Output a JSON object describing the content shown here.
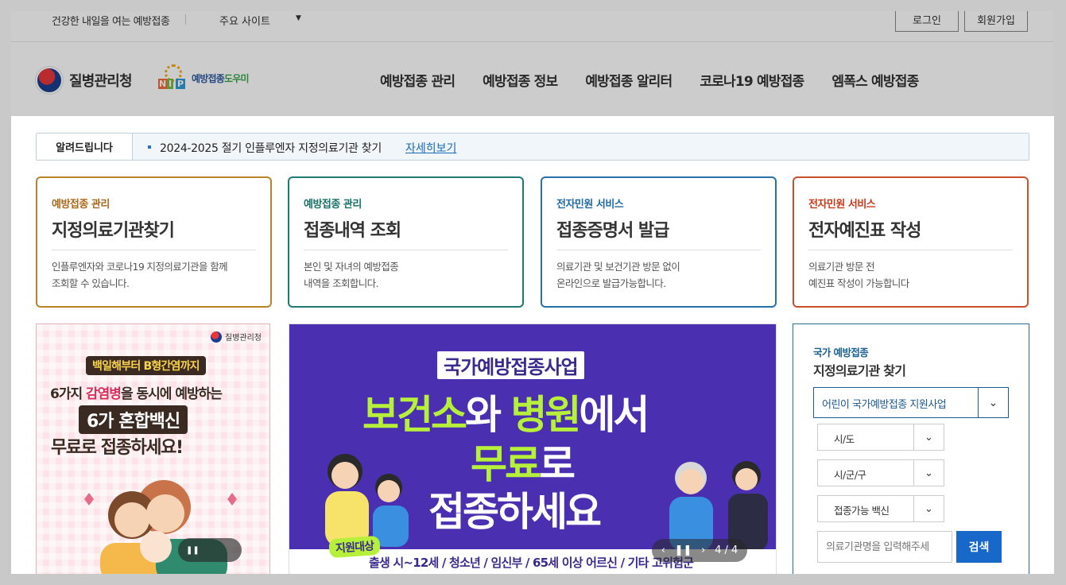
{
  "topbar": {
    "slogan": "건강한 내일을 여는 예방접종",
    "sites_label": "주요 사이트",
    "sites_caret": "▼",
    "login": "로그인",
    "signup": "회원가입"
  },
  "header": {
    "kdca_name": "질병관리청",
    "nip_letters": [
      "N",
      "I",
      "P"
    ],
    "nip_name_a": "예방접종",
    "nip_name_b": "도우미",
    "nav": [
      "예방접종 관리",
      "예방접종 정보",
      "예방접종 알리터",
      "코로나19 예방접종",
      "엠폭스 예방접종"
    ]
  },
  "notice": {
    "tag": "알려드립니다",
    "text": "2024-2025 절기 인플루엔자 지정의료기관 찾기",
    "more": "자세히보기"
  },
  "cards": [
    {
      "category": "예방접종 관리",
      "title": "지정의료기관찾기",
      "desc1": "인플루엔자와 코로나19 지정의료기관을 함께",
      "desc2": "조회할 수 있습니다."
    },
    {
      "category": "예방접종 관리",
      "title": "접종내역 조회",
      "desc1": "본인 및 자녀의 예방접종",
      "desc2": "내역을 조회합니다."
    },
    {
      "category": "전자민원 서비스",
      "title": "접종증명서 발급",
      "desc1": "의료기관 및 보건기관 방문 없이",
      "desc2": "온라인으로 발급가능합니다."
    },
    {
      "category": "전자민원 서비스",
      "title": "전자예진표 작성",
      "desc1": "의료기관 방문 전",
      "desc2": "예진표 작성이 가능합니다"
    }
  ],
  "banner_left": {
    "logo": "질병관리청",
    "pill": "백일해부터 B형간염까지",
    "line2_a": "6가지 ",
    "line2_b": "감염병",
    "line2_c": "을 동시에 예방하는",
    "box": "6가 혼합백신",
    "line4": "무료로 접종하세요!",
    "pause": "❚❚"
  },
  "banner_center": {
    "title": "국가예방접종사업",
    "line1_a": "보건소",
    "line1_b": "와 ",
    "line1_c": "병원",
    "line1_d": "에서",
    "line2_a": "무료",
    "line2_b": "로",
    "line3": "접종하세요",
    "target": "지원대상",
    "groups": "출생 시~12세 / 청소년 / 임신부 / 65세 이상 어르신 / 기타 고위험군",
    "prev": "‹",
    "pause": "❚❚",
    "next": "›",
    "page": "4 / 4"
  },
  "finder": {
    "sub": "국가 예방접종",
    "title": "지정의료기관 찾기",
    "program": "어린이 국가예방접종 지원사업",
    "sido": "시/도",
    "sigungu": "시/군/구",
    "vaccine": "접종가능 백신",
    "search_placeholder": "의료기관명을 입력해주세",
    "search_button": "검색",
    "arrow": "⌄"
  },
  "colors": {
    "primary_blue": "#1768c9",
    "card1": "#b88427",
    "card2": "#1f7a73",
    "card3": "#2a70a8",
    "card4": "#c9502a",
    "banner_purple": "#4a2fb0",
    "highlight_green": "#b6f03a"
  },
  "icons": [
    "kdca-emblem-icon",
    "nip-sun-icon",
    "chevron-down-icon",
    "pause-icon",
    "chevron-left-icon",
    "chevron-right-icon"
  ]
}
